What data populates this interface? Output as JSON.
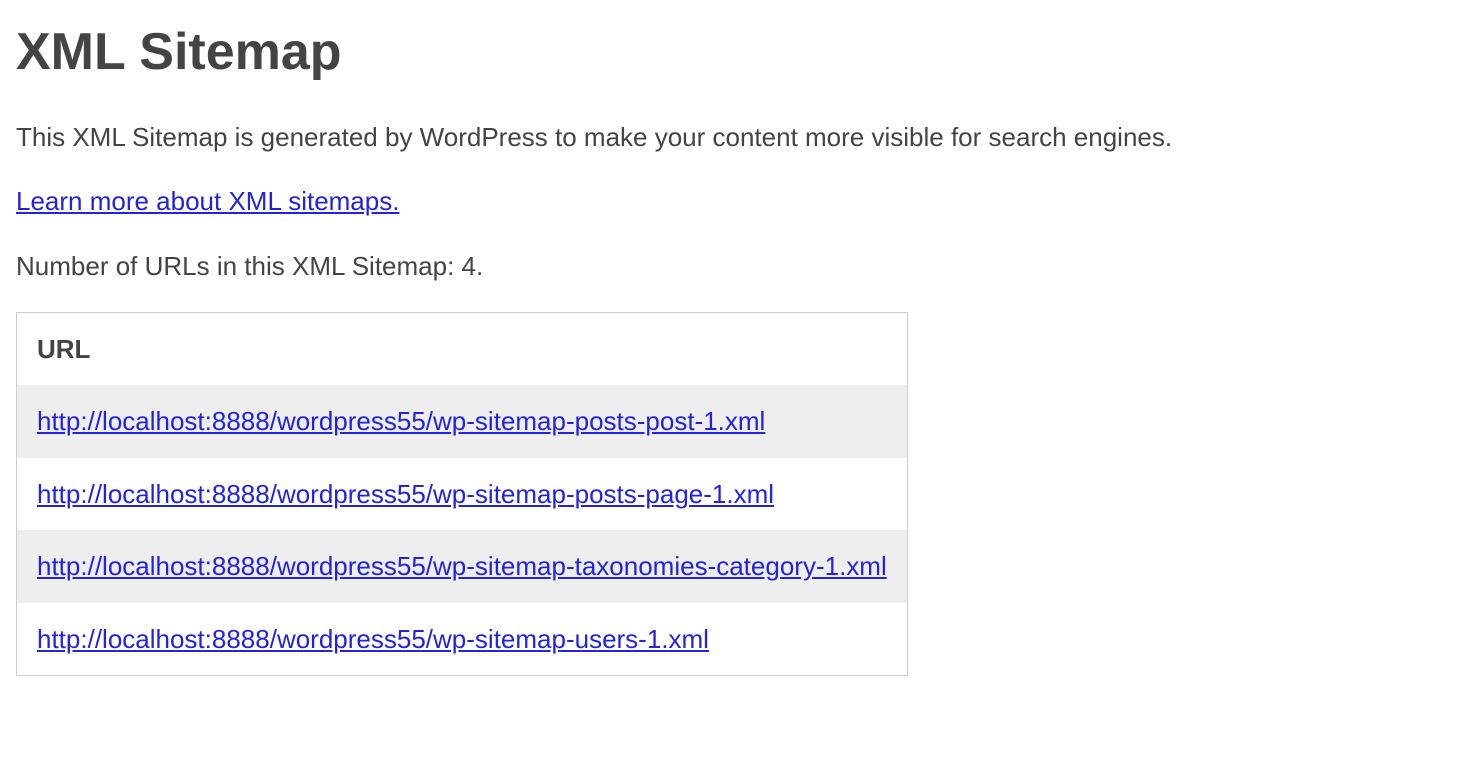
{
  "title": "XML Sitemap",
  "description": "This XML Sitemap is generated by WordPress to make your content more visible for search engines.",
  "learn_more_link": "Learn more about XML sitemaps.",
  "url_count_text": "Number of URLs in this XML Sitemap: 4.",
  "table": {
    "header": "URL",
    "rows": [
      "http://localhost:8888/wordpress55/wp-sitemap-posts-post-1.xml",
      "http://localhost:8888/wordpress55/wp-sitemap-posts-page-1.xml",
      "http://localhost:8888/wordpress55/wp-sitemap-taxonomies-category-1.xml",
      "http://localhost:8888/wordpress55/wp-sitemap-users-1.xml"
    ]
  }
}
